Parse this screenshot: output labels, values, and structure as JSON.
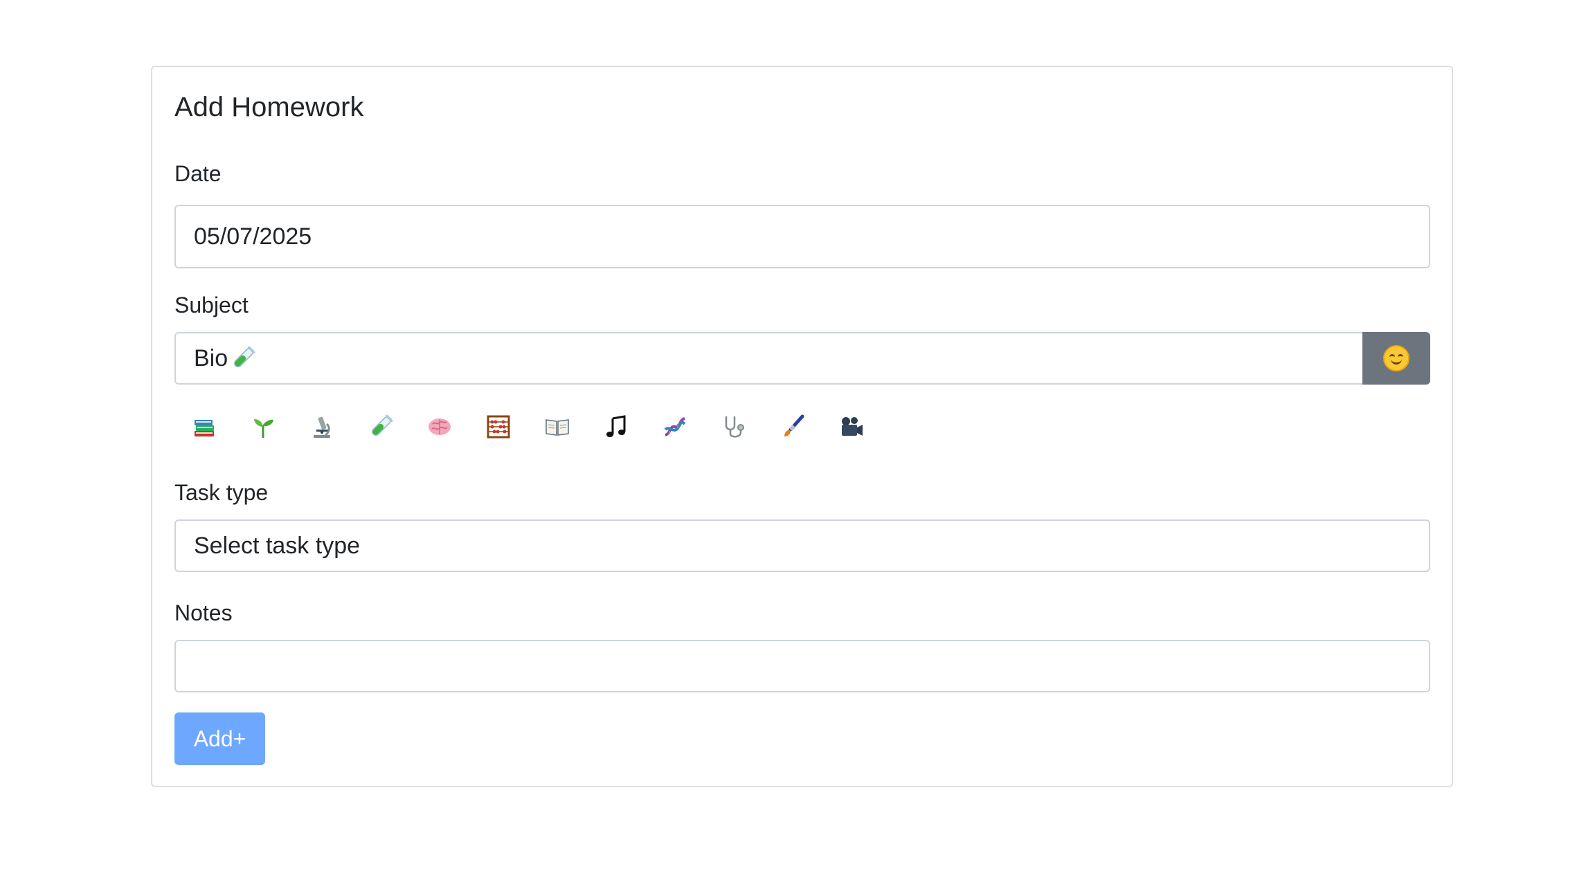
{
  "form": {
    "title": "Add Homework",
    "date_label": "Date",
    "date_value": "05/07/2025",
    "subject_label": "Subject",
    "subject_value": "Bio",
    "subject_value_icon": "test-tube-icon",
    "emoji_button_icon": "smiling-face-icon",
    "task_type_label": "Task type",
    "task_type_placeholder": "Select task type",
    "notes_label": "Notes",
    "notes_value": "",
    "submit_label": "Add+"
  },
  "emoji_palette": [
    "books-icon",
    "seedling-icon",
    "microscope-icon",
    "test-tube-icon",
    "brain-icon",
    "abacus-icon",
    "open-book-icon",
    "musical-note-icon",
    "dna-icon",
    "stethoscope-icon",
    "paintbrush-icon",
    "film-camera-icon"
  ],
  "colors": {
    "emoji_button_bg": "#6c757d",
    "submit_button_bg": "#6ea8fe",
    "border": "#ced4da"
  }
}
